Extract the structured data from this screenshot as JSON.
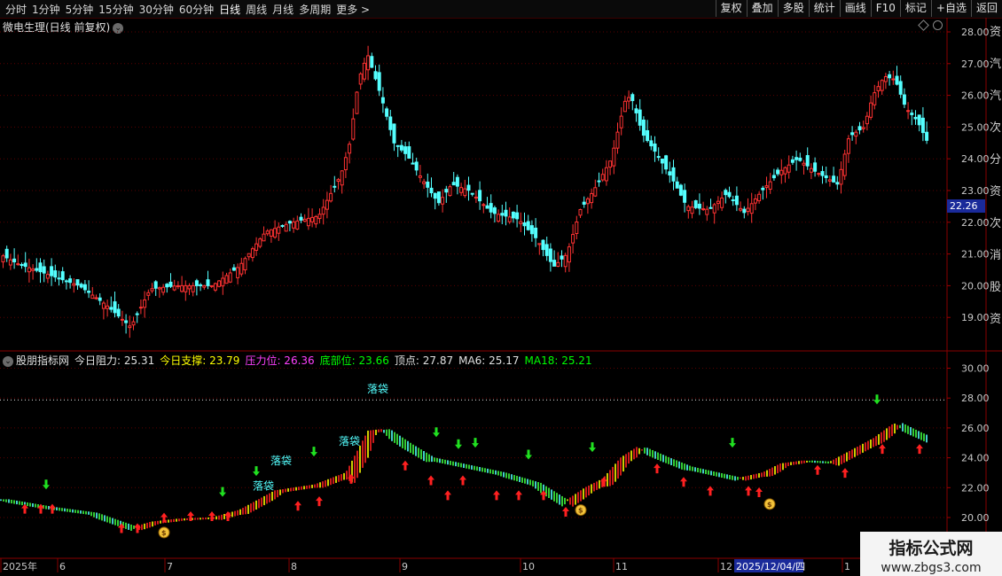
{
  "toolbar": {
    "periods": [
      "分时",
      "1分钟",
      "5分钟",
      "15分钟",
      "30分钟",
      "60分钟",
      "日线",
      "周线",
      "月线",
      "多周期",
      "更多 >"
    ],
    "active": "日线",
    "buttons": [
      "复权",
      "叠加",
      "多股",
      "统计",
      "画线",
      "F10",
      "标记",
      "+自选",
      "返回"
    ]
  },
  "main_chart": {
    "title": "微电生理(日线 前复权)",
    "current_price": "22.26",
    "y_axis_ticks": [
      "28.00",
      "27.00",
      "26.00",
      "25.00",
      "24.00",
      "23.00",
      "22.00",
      "21.00",
      "20.00",
      "19.00"
    ],
    "up_color": "#ff3232",
    "down_color": "#54ffff"
  },
  "sub_chart": {
    "name": "股朋指标网",
    "legend": [
      {
        "label": "今日阻力: ",
        "value": "25.31",
        "color": "#e0e0e0"
      },
      {
        "label": "今日支撑: ",
        "value": "23.79",
        "color": "#ffff00"
      },
      {
        "label": "压力位: ",
        "value": "26.36",
        "color": "#ff40ff"
      },
      {
        "label": "底部位: ",
        "value": "23.66",
        "color": "#00ff00"
      },
      {
        "label": "顶点: ",
        "value": "27.87",
        "color": "#e0e0e0"
      },
      {
        "label": "MA6: ",
        "value": "25.17",
        "color": "#e0e0e0"
      },
      {
        "label": "MA18: ",
        "value": "25.21",
        "color": "#00ff00"
      }
    ],
    "y_axis_ticks": [
      "30.00",
      "28.00",
      "26.00",
      "24.00",
      "22.00",
      "20.00"
    ],
    "annotation": "落袋"
  },
  "x_axis": {
    "labels": [
      "2025年",
      "6",
      "7",
      "8",
      "9",
      "10",
      "11",
      "12",
      "1"
    ],
    "highlight_date": "2025/12/04/四"
  },
  "right_panel_chars": [
    "资",
    "汽",
    "汽",
    "次",
    "分",
    "资",
    "次",
    "消",
    "股",
    "资"
  ],
  "watermark": {
    "line1": "指标公式网",
    "line2": "www.zbgs3.com"
  }
}
